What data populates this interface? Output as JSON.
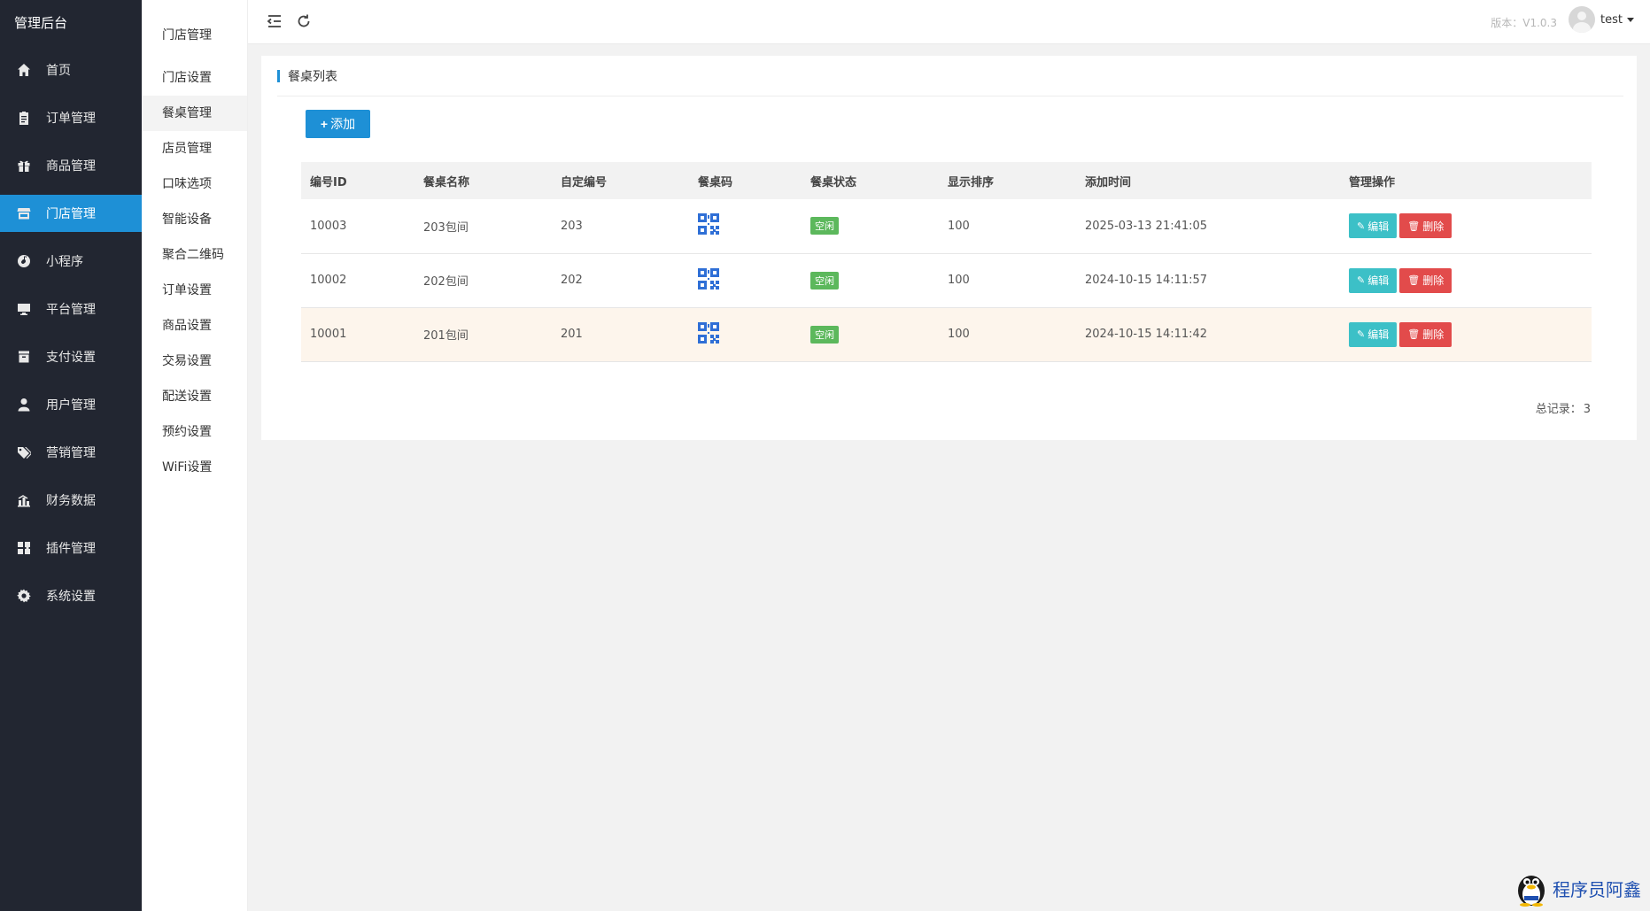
{
  "app": {
    "title": "管理后台"
  },
  "sidebar": {
    "items": [
      {
        "label": "首页",
        "icon": "home-icon",
        "active": false
      },
      {
        "label": "订单管理",
        "icon": "clipboard-icon",
        "active": false
      },
      {
        "label": "商品管理",
        "icon": "gift-icon",
        "active": false
      },
      {
        "label": "门店管理",
        "icon": "store-icon",
        "active": true
      },
      {
        "label": "小程序",
        "icon": "music-disc-icon",
        "active": false
      },
      {
        "label": "平台管理",
        "icon": "monitor-icon",
        "active": false
      },
      {
        "label": "支付设置",
        "icon": "archive-icon",
        "active": false
      },
      {
        "label": "用户管理",
        "icon": "user-icon",
        "active": false
      },
      {
        "label": "营销管理",
        "icon": "tags-icon",
        "active": false
      },
      {
        "label": "财务数据",
        "icon": "chart-icon",
        "active": false
      },
      {
        "label": "插件管理",
        "icon": "puzzle-icon",
        "active": false
      },
      {
        "label": "系统设置",
        "icon": "gear-icon",
        "active": false
      }
    ]
  },
  "subnav": {
    "title": "门店管理",
    "items": [
      "门店设置",
      "餐桌管理",
      "店员管理",
      "口味选项",
      "智能设备",
      "聚合二维码",
      "订单设置",
      "商品设置",
      "交易设置",
      "配送设置",
      "预约设置",
      "WiFi设置"
    ],
    "active_index": 1
  },
  "header": {
    "version": "版本：V1.0.3",
    "user": "test"
  },
  "card": {
    "title": "餐桌列表",
    "add_label": "添加",
    "columns": [
      "编号ID",
      "餐桌名称",
      "自定编号",
      "餐桌码",
      "餐桌状态",
      "显示排序",
      "添加时间",
      "管理操作"
    ],
    "rows": [
      {
        "id": "10003",
        "name": "203包间",
        "code": "203",
        "status": "空闲",
        "sort": "100",
        "time": "2025-03-13 21:41:05",
        "highlight": false
      },
      {
        "id": "10002",
        "name": "202包间",
        "code": "202",
        "status": "空闲",
        "sort": "100",
        "time": "2024-10-15 14:11:57",
        "highlight": false
      },
      {
        "id": "10001",
        "name": "201包间",
        "code": "201",
        "status": "空闲",
        "sort": "100",
        "time": "2024-10-15 14:11:42",
        "highlight": true
      }
    ],
    "edit_label": "编辑",
    "delete_label": "删除",
    "total_label": "总记录：",
    "total_value": "3"
  },
  "watermark": {
    "text": "程序员阿鑫"
  },
  "colors": {
    "sidebar_bg": "#222631",
    "accent": "#1e90d6",
    "edit": "#3cc0c7",
    "delete": "#e24b4b",
    "status_free": "#5cb85c"
  }
}
